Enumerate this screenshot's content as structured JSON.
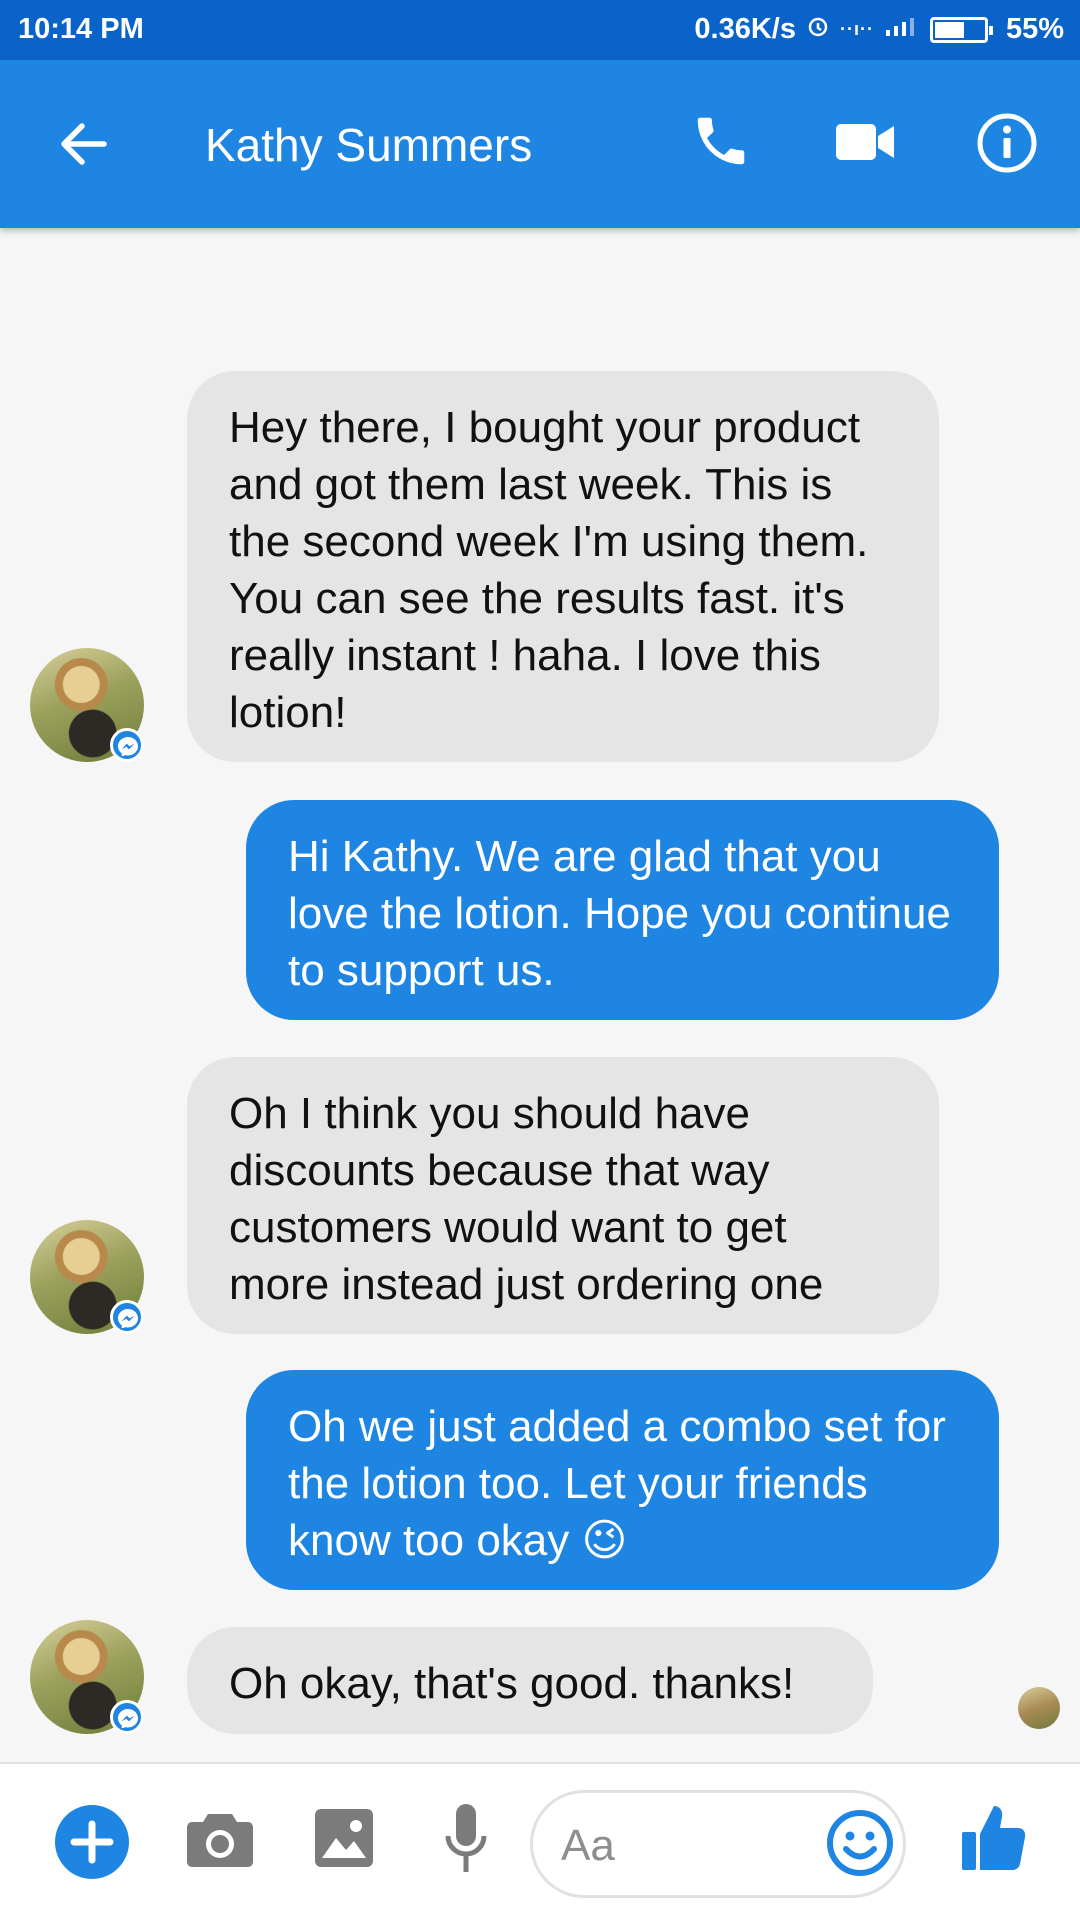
{
  "status_bar": {
    "time": "10:14 PM",
    "speed": "0.36K/s",
    "battery_percent": "55%",
    "battery_level": 0.55
  },
  "header": {
    "title": "Kathy Summers",
    "icons": [
      "back-arrow-icon",
      "phone-icon",
      "video-camera-icon",
      "info-icon"
    ]
  },
  "messages": [
    {
      "direction": "in",
      "text": "Hey there, I bought your product and got them last week. This is the second week I'm using them. You can see the results fast. it's really instant ! haha. I love this lotion!"
    },
    {
      "direction": "out",
      "text": "Hi Kathy. We are glad that you love the lotion. Hope you continue to support us."
    },
    {
      "direction": "in",
      "text": "Oh I think you should have discounts because that way customers would want to get more instead just ordering one"
    },
    {
      "direction": "out",
      "text": "Oh we just added a combo set for the lotion too. Let your friends know too okay",
      "emoji": "😉"
    },
    {
      "direction": "in",
      "text": "Oh okay, that's good. thanks!"
    }
  ],
  "composer": {
    "placeholder": "Aa",
    "icons": [
      "plus-icon",
      "camera-icon",
      "image-icon",
      "microphone-icon",
      "emoji-icon",
      "thumbs-up-icon"
    ]
  },
  "colors": {
    "status_bar": "#0a63c9",
    "header": "#1e85e3",
    "outgoing_bubble": "#1e85e3",
    "incoming_bubble": "#e5e5e5"
  }
}
